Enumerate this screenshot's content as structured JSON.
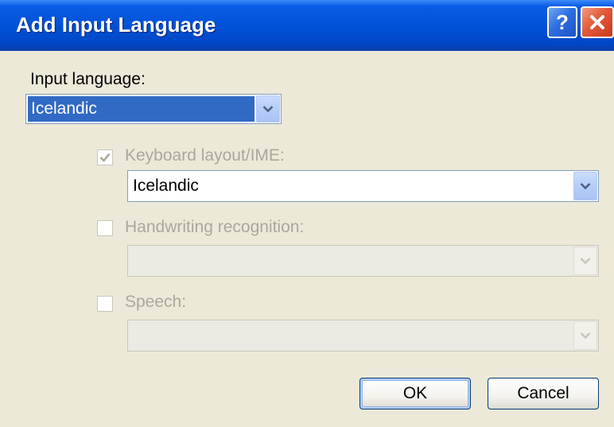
{
  "window": {
    "title": "Add Input Language",
    "help_glyph": "?"
  },
  "input_language": {
    "label": "Input language:",
    "value": "Icelandic"
  },
  "keyboard_layout": {
    "label": "Keyboard layout/IME:",
    "checked": true,
    "enabled": false,
    "value": "Icelandic"
  },
  "handwriting": {
    "label": "Handwriting recognition:",
    "checked": false,
    "enabled": false,
    "value": ""
  },
  "speech": {
    "label": "Speech:",
    "checked": false,
    "enabled": false,
    "value": ""
  },
  "buttons": {
    "ok": "OK",
    "cancel": "Cancel"
  },
  "colors": {
    "titlebar": "#0152d6",
    "dialog_bg": "#ece9d8",
    "selection": "#316ac5",
    "disabled_text": "#aca899"
  },
  "icons": [
    "help-icon",
    "close-icon",
    "dropdown-arrow-icon",
    "checkmark-icon"
  ]
}
